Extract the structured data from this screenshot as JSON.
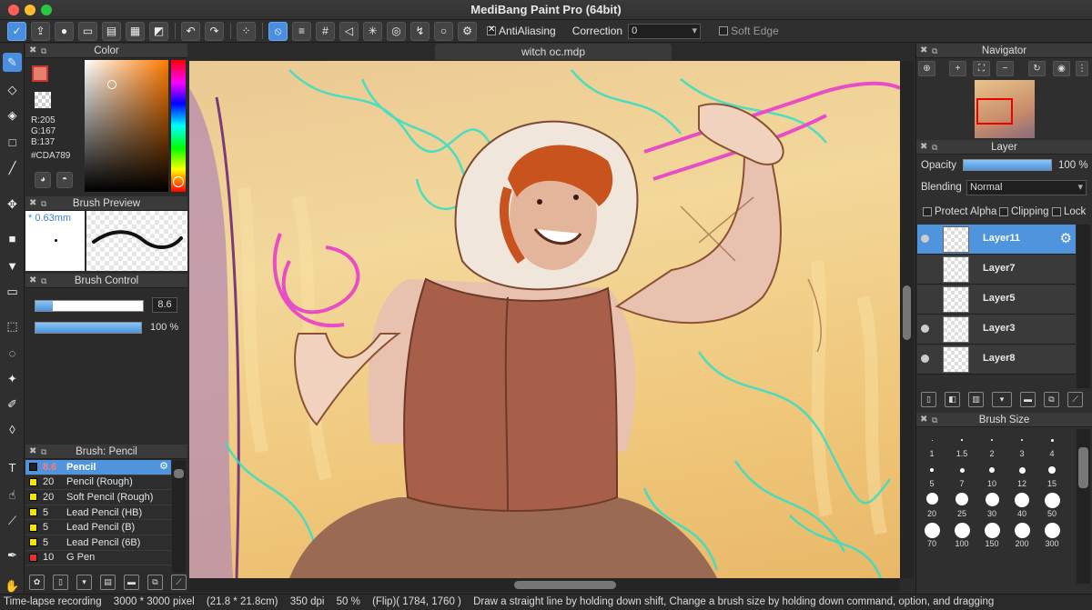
{
  "app": {
    "title": "MediBang Paint Pro (64bit)"
  },
  "toolbar": {
    "antialiasing_label": "AntiAliasing",
    "correction_label": "Correction",
    "correction_value": "0",
    "soft_edge_label": "Soft Edge"
  },
  "color_panel": {
    "title": "Color",
    "r": "R:205",
    "g": "G:167",
    "b": "B:137",
    "hex": "#CDA789",
    "front_color": "#e3806c",
    "back_color": "#f3c89c"
  },
  "brush_preview": {
    "title": "Brush Preview",
    "size_text": "* 0.63mm"
  },
  "brush_control": {
    "title": "Brush Control",
    "size_value": "8.6",
    "size_fraction": 0.16,
    "opacity_value": "100 %",
    "opacity_fraction": 1.0
  },
  "brush_panel": {
    "title": "Brush: Pencil",
    "items": [
      {
        "size": "8.6",
        "name": "Pencil",
        "color": "#222222",
        "selected": true
      },
      {
        "size": "20",
        "name": "Pencil (Rough)",
        "color": "#f4e400"
      },
      {
        "size": "20",
        "name": "Soft Pencil (Rough)",
        "color": "#f4e400"
      },
      {
        "size": "5",
        "name": "Lead Pencil (HB)",
        "color": "#f4e400"
      },
      {
        "size": "5",
        "name": "Lead Pencil (B)",
        "color": "#f4e400"
      },
      {
        "size": "5",
        "name": "Lead Pencil (6B)",
        "color": "#f4e400"
      },
      {
        "size": "10",
        "name": "G Pen",
        "color": "#e53030"
      }
    ]
  },
  "document": {
    "tab_title": "witch oc.mdp"
  },
  "status": {
    "timelapse": "Time-lapse recording",
    "pixel_size": "3000 * 3000 pixel",
    "cm_size": "(21.8 * 21.8cm)",
    "dpi": "350 dpi",
    "zoom": "50 %",
    "flip_coords": "(Flip)( 1784, 1760 )",
    "hint": "Draw a straight line by holding down shift, Change a brush size by holding down command, option, and dragging"
  },
  "navigator": {
    "title": "Navigator"
  },
  "layer_panel": {
    "title": "Layer",
    "opacity_label": "Opacity",
    "opacity_value": "100 %",
    "opacity_fraction": 1.0,
    "blending_label": "Blending",
    "blending_value": "Normal",
    "protect_alpha": "Protect Alpha",
    "clipping": "Clipping",
    "lock": "Lock",
    "layers": [
      {
        "name": "Layer11",
        "visible": true,
        "selected": true
      },
      {
        "name": "Layer7",
        "visible": false
      },
      {
        "name": "Layer5",
        "visible": false
      },
      {
        "name": "Layer3",
        "visible": true
      },
      {
        "name": "Layer8",
        "visible": true
      }
    ]
  },
  "brush_size_panel": {
    "title": "Brush Size",
    "sizes": [
      "1",
      "1.5",
      "2",
      "3",
      "4",
      "5",
      "7",
      "10",
      "12",
      "15",
      "20",
      "25",
      "30",
      "40",
      "50",
      "70",
      "100",
      "150",
      "200",
      "300"
    ]
  }
}
